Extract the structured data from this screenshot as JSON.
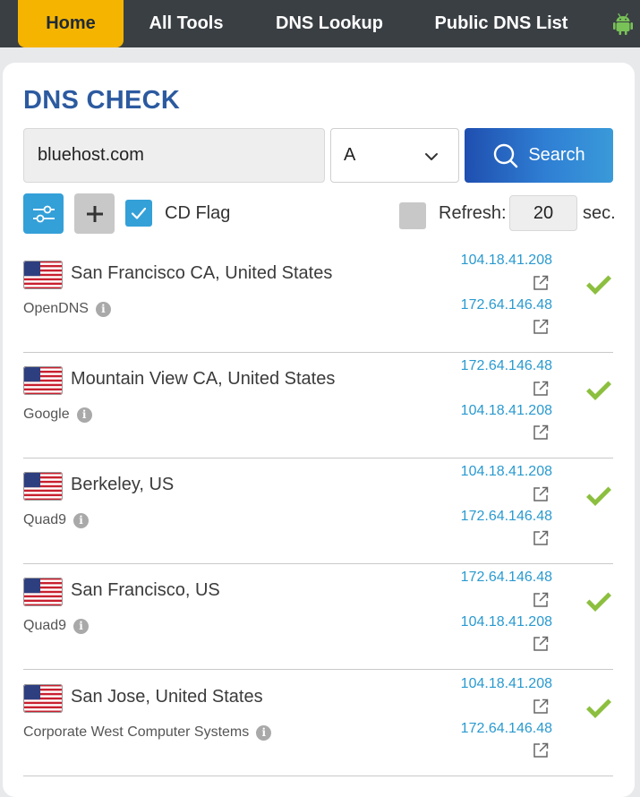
{
  "nav": {
    "tabs": [
      {
        "label": "Home",
        "active": true
      },
      {
        "label": "All Tools",
        "active": false
      },
      {
        "label": "DNS Lookup",
        "active": false
      },
      {
        "label": "Public DNS List",
        "active": false
      }
    ],
    "android_icon": "android-icon"
  },
  "page": {
    "title": "DNS CHECK"
  },
  "search": {
    "domain_value": "bluehost.com",
    "record_type": "A",
    "button_label": "Search"
  },
  "options": {
    "cd_flag_label": "CD Flag",
    "cd_flag_checked": true,
    "refresh_label": "Refresh:",
    "refresh_checked": false,
    "refresh_interval": "20",
    "sec_label": "sec."
  },
  "colors": {
    "accent_blue": "#34a0d8",
    "nav_active": "#f5b400",
    "nav_bg": "#3a3f44",
    "title": "#2c5aa0",
    "ip_link": "#2a9ad0",
    "check_green": "#8cbf3f"
  },
  "results": [
    {
      "location": "San Francisco CA, United States",
      "provider": "OpenDNS",
      "ips": [
        "104.18.41.208",
        "172.64.146.48"
      ],
      "status": "ok"
    },
    {
      "location": "Mountain View CA, United States",
      "provider": "Google",
      "ips": [
        "172.64.146.48",
        "104.18.41.208"
      ],
      "status": "ok"
    },
    {
      "location": "Berkeley, US",
      "provider": "Quad9",
      "ips": [
        "104.18.41.208",
        "172.64.146.48"
      ],
      "status": "ok"
    },
    {
      "location": "San Francisco, US",
      "provider": "Quad9",
      "ips": [
        "172.64.146.48",
        "104.18.41.208"
      ],
      "status": "ok"
    },
    {
      "location": "San Jose, United States",
      "provider": "Corporate West Computer Systems",
      "ips": [
        "104.18.41.208",
        "172.64.146.48"
      ],
      "status": "ok"
    }
  ]
}
